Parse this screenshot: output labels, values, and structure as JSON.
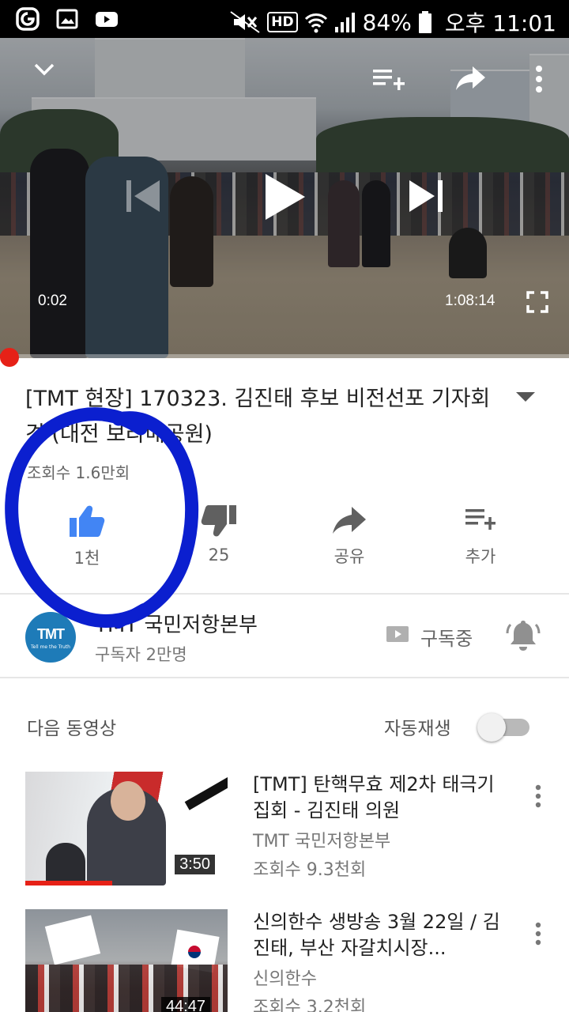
{
  "status_bar": {
    "battery": "84%",
    "time": "오후 11:01",
    "hd_badge": "HD",
    "icons": [
      "notification-icon",
      "gallery-icon",
      "youtube-icon",
      "mute-icon",
      "hd-voice-icon",
      "wifi-icon",
      "signal-icon",
      "battery-icon"
    ]
  },
  "player": {
    "current_time": "0:02",
    "duration": "1:08:14",
    "progress_fraction": 0.0005,
    "progress_color": "#e62117",
    "controls": [
      "collapse-icon",
      "add-to-playlist-icon",
      "share-icon",
      "more-icon",
      "previous-icon",
      "play-icon",
      "next-icon",
      "fullscreen-icon"
    ]
  },
  "video": {
    "title": "[TMT 현장] 170323. 김진태 후보 비전선포 기자회견 (대전 보라매공원)",
    "views": "조회수 1.6만회"
  },
  "actions": {
    "like_count": "1천",
    "dislike_count": "25",
    "share_label": "공유",
    "add_label": "추가",
    "like_color": "#4285f4"
  },
  "channel": {
    "logo_text": "TMT",
    "logo_tagline": "Tell me the Truth",
    "name": "TMT 국민저항본부",
    "subscribers": "구독자 2만명",
    "subscribe_state": "구독중"
  },
  "up_next": {
    "heading": "다음 동영상",
    "autoplay_label": "자동재생",
    "autoplay_on": false
  },
  "videos": [
    {
      "title": "[TMT] 탄핵무효 제2차 태극기 집회 - 김진태 의원",
      "channel": "TMT 국민저항본부",
      "views": "조회수 9.3천회",
      "duration": "3:50"
    },
    {
      "title": "신의한수 생방송  3월 22일 / 김진태, 부산 자갈치시장...",
      "channel": "신의한수",
      "views": "조회수 3.2천회",
      "duration": "44:47"
    }
  ],
  "annotation": {
    "color": "#0b1fcf",
    "shape": "hand-drawn circle around like button"
  }
}
